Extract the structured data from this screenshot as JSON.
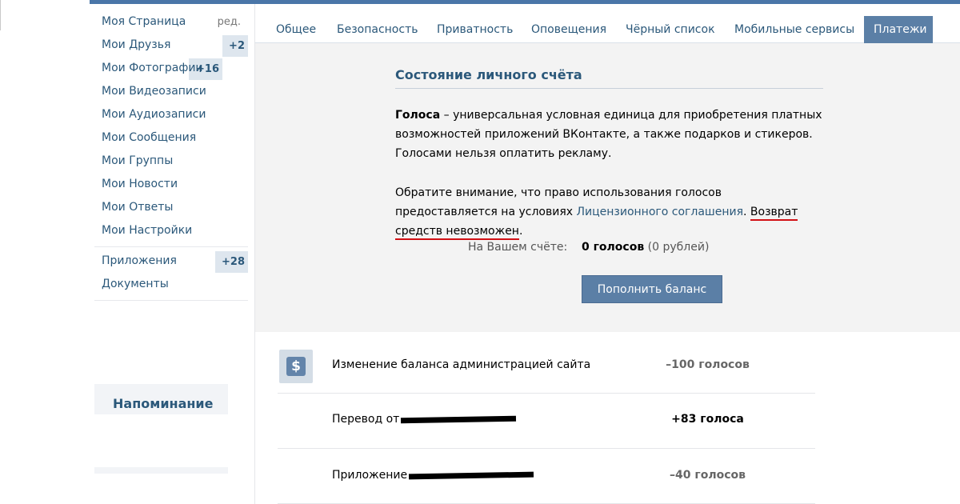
{
  "sidebar": {
    "items": [
      {
        "label": "Моя Страница",
        "edit": "ред."
      },
      {
        "label": "Мои Друзья",
        "badge": "+2"
      },
      {
        "label": "Мои Фотографии",
        "badge": "+16"
      },
      {
        "label": "Мои Видеозаписи"
      },
      {
        "label": "Мои Аудиозаписи"
      },
      {
        "label": "Мои Сообщения"
      },
      {
        "label": "Мои Группы"
      },
      {
        "label": "Мои Новости"
      },
      {
        "label": "Мои Ответы"
      },
      {
        "label": "Мои Настройки"
      }
    ],
    "extra": [
      {
        "label": "Приложения",
        "badge": "+28"
      },
      {
        "label": "Документы"
      }
    ],
    "reminder": "Напоминание"
  },
  "tabs": [
    "Общее",
    "Безопасность",
    "Приватность",
    "Оповещения",
    "Чёрный список",
    "Мобильные сервисы",
    "Платежи"
  ],
  "active_tab": "Платежи",
  "balance": {
    "title": "Состояние личного счёта",
    "p1_bold": "Голоса",
    "p1_rest": " – универсальная условная единица для приобретения платных возможностей приложений ВКонтакте, а также подарков и стикеров. Голосами нельзя оплатить рекламу.",
    "p2_start": "Обратите внимание, что право использования голосов предоставляется на условиях ",
    "p2_link": "Лицензионного соглашения",
    "p2_mid": ". ",
    "p2_warning": "Возврат средств невозможен",
    "p2_end": ".",
    "account_label": "На Вашем счёте:",
    "account_value": "0 голосов",
    "account_rub": "(0 рублей)",
    "topup_button": "Пополнить баланс"
  },
  "transactions": [
    {
      "icon": "dollar-icon",
      "desc": "Изменение баланса администрацией сайта",
      "amount": "–100 голосов",
      "sign": "neg"
    },
    {
      "desc": "Перевод от",
      "redacted": true,
      "amount": "+83 голоса",
      "sign": "pos"
    },
    {
      "desc": "Приложение",
      "redacted": true,
      "amount": "–40 голосов",
      "sign": "neg"
    }
  ],
  "colors": {
    "brand": "#4a76a8",
    "link": "#2b587a",
    "button": "#5b7fa6",
    "warning_underline": "#d21015"
  }
}
